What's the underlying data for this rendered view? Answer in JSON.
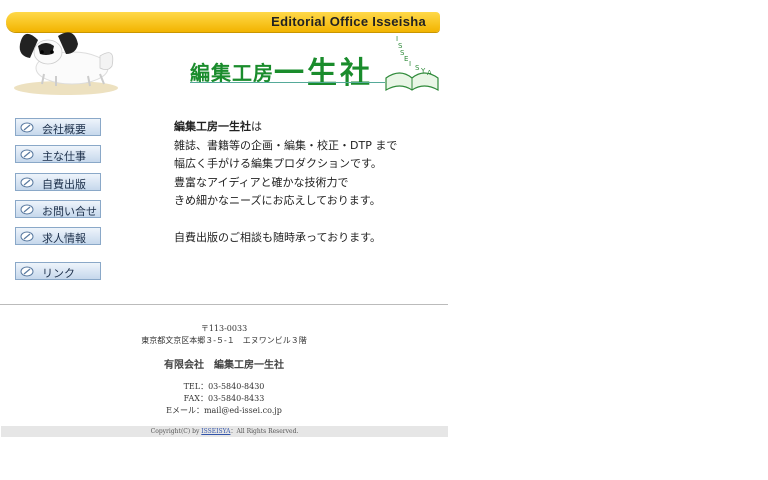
{
  "header": {
    "title": "Editorial Office Isseisha",
    "logo_small": "編集工房",
    "logo_big": "一生社",
    "book_letters": [
      "I",
      "S",
      "S",
      "E",
      "I",
      "S",
      "Y",
      "A"
    ]
  },
  "nav": {
    "items": [
      {
        "label": "会社概要"
      },
      {
        "label": "主な仕事"
      },
      {
        "label": "自費出版"
      },
      {
        "label": "お問い合せ"
      },
      {
        "label": "求人情報"
      },
      {
        "label": "リンク"
      }
    ]
  },
  "intro": {
    "lines": [
      {
        "bold": "編集工房一生社",
        "text": "は"
      },
      {
        "text": "雑誌、書籍等の企画・編集・校正・DTP まで"
      },
      {
        "text": "幅広く手がける編集プロダクションです。"
      },
      {
        "text": "豊富なアイディアと確かな技術力で"
      },
      {
        "text": "きめ細かなニーズにお応えしております。"
      }
    ],
    "note": "自費出版のご相談も随時承っております。"
  },
  "footer": {
    "postal": "〒113-0033",
    "address": "東京都文京区本郷３-５-１　エヌワンビル３階",
    "company": "有限会社　編集工房一生社",
    "tel": "TEL：03-5840-8430",
    "fax": "FAX：03-5840-8433",
    "email": "Eメール：mail@ed-issei.co.jp",
    "copyright_prefix": "Copyright(C) by",
    "copyright_link": "ISSEISYA",
    "copyright_suffix": "：All Rights Reserved."
  }
}
